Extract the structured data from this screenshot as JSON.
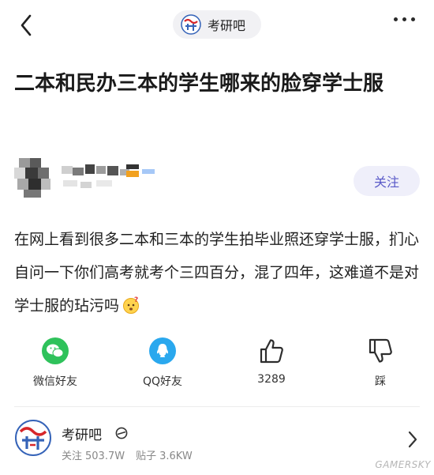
{
  "header": {
    "forum_name": "考研吧"
  },
  "post": {
    "title": "二本和民办三本的学生哪来的脸穿学士服",
    "follow_label": "关注",
    "content": "在网上看到很多二本和三本的学生拍毕业照还穿学士服，扪心自问一下你们高考就考个三四百分，混了四年，这难道不是对学士服的玷污吗"
  },
  "actions": {
    "wechat_label": "微信好友",
    "qq_label": "QQ好友",
    "like_count": "3289",
    "dislike_label": "踩"
  },
  "forum_card": {
    "name": "考研吧",
    "follow_label": "关注",
    "follow_count": "503.7W",
    "posts_label": "贴子",
    "posts_count": "3.6KW"
  },
  "watermark": "GAMERSKY",
  "colors": {
    "accent": "#5a5ac8",
    "wechat": "#2fc25b",
    "qq": "#2aa8ee"
  }
}
